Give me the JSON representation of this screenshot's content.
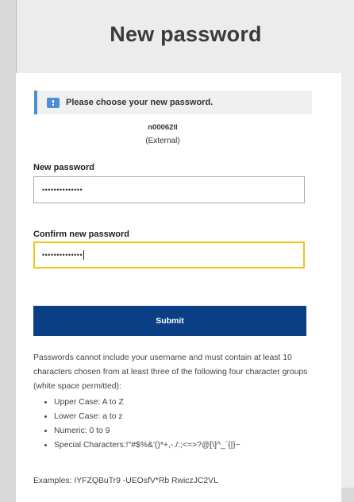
{
  "page": {
    "title": "New password"
  },
  "info": {
    "message": "Please choose your new password."
  },
  "user": {
    "username": "n00062ll",
    "account_type": "(External)"
  },
  "form": {
    "new_password_label": "New password",
    "new_password_value": "••••••••••••••",
    "confirm_password_label": "Confirm new password",
    "confirm_password_value": "••••••••••••••",
    "submit_label": "Submit"
  },
  "rules": {
    "intro": "Passwords cannot include your username and must contain at least 10 characters chosen from at least three of the following four character groups (white space permitted):",
    "groups": [
      "Upper Case: A to Z",
      "Lower Case: a to z",
      "Numeric: 0 to 9",
      "Special Characters:!\"#$%&'()*+,-./:;<=>?@[\\]^_`{|}~"
    ],
    "examples": "Examples: IYFZQBuTr9 -UEOsfV*Rb RwiczJC2VL"
  },
  "colors": {
    "accent_blue": "#0a3f86",
    "info_bar": "#4a90c9",
    "focus_border": "#f0c419"
  },
  "icons": {
    "info_icon": "message-info-icon"
  }
}
